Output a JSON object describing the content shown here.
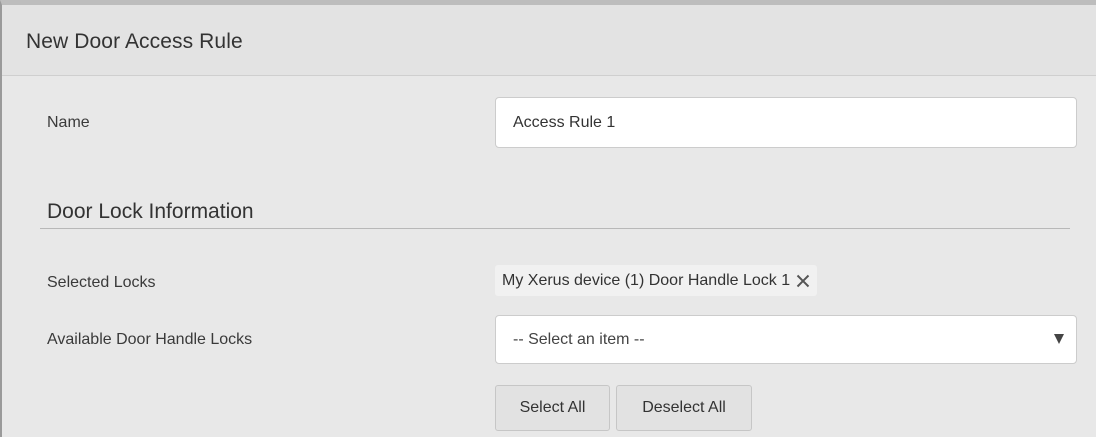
{
  "dialog": {
    "title": "New Door Access Rule"
  },
  "name_field": {
    "label": "Name",
    "value": "Access Rule 1"
  },
  "door_lock_section": {
    "title": "Door Lock Information",
    "selected_locks_label": "Selected Locks",
    "selected_locks": [
      {
        "label": "My Xerus device (1) Door Handle Lock 1",
        "remove_icon": "close-x-icon"
      }
    ],
    "available_label": "Available Door Handle Locks",
    "available_select": {
      "selected_value": "-- Select an item --",
      "arrow_icon": "dropdown-triangle-icon"
    },
    "select_all_label": "Select All",
    "deselect_all_label": "Deselect All"
  }
}
